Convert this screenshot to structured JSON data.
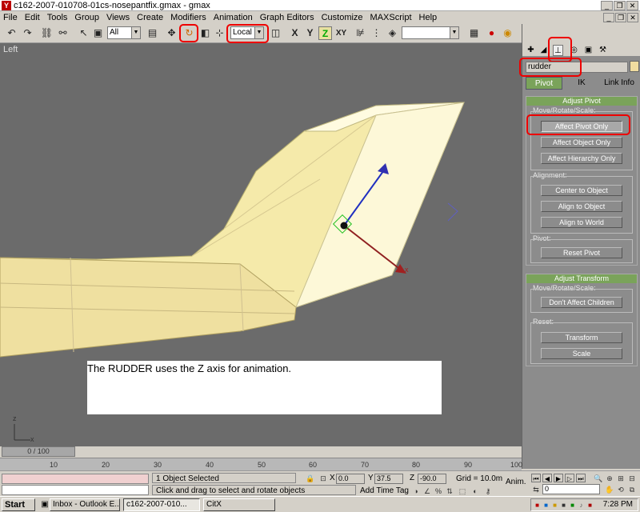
{
  "window": {
    "title": "c162-2007-010708-01cs-nosepantfix.gmax - gmax",
    "min": "_",
    "restore": "❐",
    "close": "✕"
  },
  "menu": [
    "File",
    "Edit",
    "Tools",
    "Group",
    "Views",
    "Create",
    "Modifiers",
    "Animation",
    "Graph Editors",
    "Customize",
    "MAXScript",
    "Help"
  ],
  "menu_mdi": {
    "min": "_",
    "restore": "❐",
    "close": "✕"
  },
  "toolbar": {
    "selection_filter": "All",
    "ref_coord_system": "Local",
    "axis_x": "X",
    "axis_y": "Y",
    "axis_z": "Z",
    "axis_xy": "XY",
    "named_selection": ""
  },
  "viewport": {
    "label": "Left",
    "caption": "The RUDDER uses the Z axis for animation.",
    "axis_z": "z",
    "axis_x": "x"
  },
  "command_panel": {
    "object_name": "rudder",
    "object_color": "#f0dca0",
    "subtabs": [
      "Pivot",
      "IK",
      "Link Info"
    ],
    "adjust_pivot": {
      "title": "Adjust Pivot",
      "move_label": "Move/Rotate/Scale:",
      "buttons": [
        "Affect Pivot Only",
        "Affect Object Only",
        "Affect Hierarchy Only"
      ],
      "alignment_label": "Alignment:",
      "align_buttons": [
        "Center to Object",
        "Align to Object",
        "Align to World"
      ],
      "pivot_label": "Pivot:",
      "reset_pivot": "Reset Pivot"
    },
    "adjust_transform": {
      "title": "Adjust Transform",
      "move_label": "Move/Rotate/Scale:",
      "dont_affect": "Don't Affect Children",
      "reset_label": "Reset:",
      "transform": "Transform",
      "scale": "Scale"
    }
  },
  "timeline": {
    "slider": "0 / 100",
    "ticks": [
      "10",
      "20",
      "30",
      "40",
      "50",
      "60",
      "70",
      "80",
      "90",
      "100"
    ]
  },
  "status": {
    "selected": "1 Object Selected",
    "prompt": "Click and drag to select and rotate objects",
    "x_label": "X",
    "x_value": "0.0",
    "y_label": "Y",
    "y_value": "37.5",
    "z_label": "Z",
    "z_value": "-90.0",
    "grid": "Grid = 10.0m",
    "add_time_tag": "Add Time Tag",
    "anim": "Anim.",
    "frame": "0"
  },
  "taskbar": {
    "start": "Start",
    "tasks": [
      "Inbox - Outlook E...",
      "c162-2007-010...",
      "CitX"
    ],
    "clock": "7:28 PM"
  }
}
